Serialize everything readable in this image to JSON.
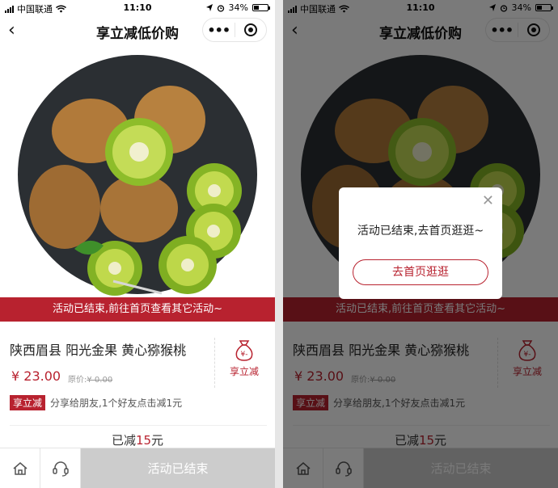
{
  "status": {
    "carrier": "中国联通",
    "time": "11:10",
    "battery": "34%",
    "battery_level": 0.34
  },
  "nav": {
    "title": "享立减低价购",
    "back_icon": "back-chevron-icon",
    "more_label": "•••"
  },
  "banner": {
    "text": "活动已结束,前往首页查看其它活动~"
  },
  "product": {
    "name": "陕西眉县 阳光金果 黄心猕猴桃",
    "price": "¥ 23.00",
    "orig_label": "原价:",
    "orig_price": "¥ 0.00"
  },
  "share": {
    "label": "享立减",
    "icon": "money-bag-icon",
    "icon_glyph": "¥-"
  },
  "tag": {
    "label": "享立减",
    "desc": "分享给朋友,1个好友点击减1元"
  },
  "reduced": {
    "prefix": "已减",
    "amount": "15",
    "suffix": "元"
  },
  "bottom": {
    "home_icon": "home-icon",
    "service_icon": "customer-service-icon",
    "main_button": "活动已结束"
  },
  "modal": {
    "message": "活动已结束,去首页逛逛~",
    "button": "去首页逛逛",
    "close_icon": "close-icon"
  },
  "colors": {
    "accent": "#b8222f",
    "disabled": "#cccccc"
  }
}
